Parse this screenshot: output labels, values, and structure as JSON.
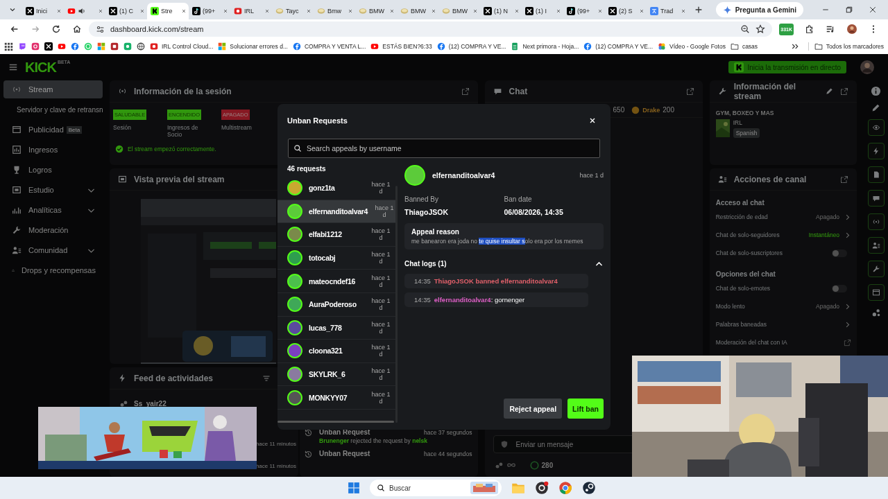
{
  "browser": {
    "tabs": [
      {
        "title": "Inici",
        "kind": "x",
        "selected": false,
        "audio": false
      },
      {
        "kind": "youtube",
        "selected": false,
        "audio": true
      },
      {
        "title": "(1) C",
        "kind": "x",
        "selected": false,
        "audio": false
      },
      {
        "title": "Stre",
        "kind": "kick",
        "selected": true,
        "audio": false
      },
      {
        "title": "(99+",
        "kind": "tiktok",
        "selected": false,
        "audio": false
      },
      {
        "title": "IRL",
        "kind": "irl",
        "selected": false,
        "audio": false
      },
      {
        "title": "Tayc",
        "kind": "coin",
        "selected": false,
        "audio": false
      },
      {
        "title": "Bmw",
        "kind": "coin",
        "selected": false,
        "audio": false
      },
      {
        "title": "BMW",
        "kind": "coin",
        "selected": false,
        "audio": false
      },
      {
        "title": "BMW",
        "kind": "coin",
        "selected": false,
        "audio": false
      },
      {
        "title": "BMW",
        "kind": "coin",
        "selected": false,
        "audio": false
      },
      {
        "title": "(1) N",
        "kind": "x",
        "selected": false,
        "audio": false
      },
      {
        "title": "(1) I",
        "kind": "x",
        "selected": false,
        "audio": false
      },
      {
        "title": "(99+",
        "kind": "tiktok",
        "selected": false,
        "audio": false
      },
      {
        "title": "(2) S",
        "kind": "x",
        "selected": false,
        "audio": false
      },
      {
        "title": "Trad",
        "kind": "translate",
        "selected": false,
        "audio": false
      }
    ],
    "gemini_button": "Pregunta a Gemini",
    "url": "dashboard.kick.com/stream",
    "extension_badge": "331K",
    "bookmarks": [
      {
        "kind": "twitch"
      },
      {
        "kind": "instagram"
      },
      {
        "kind": "x"
      },
      {
        "kind": "youtube"
      },
      {
        "kind": "facebook"
      },
      {
        "kind": "whatsapp"
      },
      {
        "kind": "microsoft"
      },
      {
        "kind": "app"
      },
      {
        "kind": "greenapp"
      },
      {
        "kind": "globe"
      },
      {
        "kind": "irl",
        "label": "IRL Control Cloud..."
      },
      {
        "kind": "microsoft",
        "label": "Solucionar errores d..."
      },
      {
        "kind": "facebook",
        "label": "COMPRA Y VENTA L..."
      },
      {
        "kind": "youtube",
        "label": "ESTÁS BIEN?6:33"
      },
      {
        "kind": "facebook",
        "label": "(12) COMPRA Y VE..."
      },
      {
        "kind": "sheets",
        "label": "Next primora - Hoja..."
      },
      {
        "kind": "facebook",
        "label": "(12) COMPRA Y VE..."
      },
      {
        "kind": "photos",
        "label": "Vídeo - Google Fotos"
      },
      {
        "kind": "folder",
        "label": "casas"
      }
    ],
    "all_bookmarks": "Todos los marcadores"
  },
  "dashboard": {
    "logo": "KICK",
    "logo_tag": "BETA",
    "go_live_button": "Inicia la transmisión en directo",
    "sidebar": [
      {
        "label": "Stream",
        "kind": "link",
        "selected": true
      },
      {
        "label": "Servidor y clave de retransn",
        "kind": "sub",
        "selected": false
      },
      {
        "label": "Publicidad",
        "kind": "link",
        "badge": "Beta",
        "selected": false
      },
      {
        "label": "Ingresos",
        "kind": "link",
        "selected": false
      },
      {
        "label": "Logros",
        "kind": "link",
        "selected": false
      },
      {
        "label": "Estudio",
        "kind": "group",
        "selected": false
      },
      {
        "label": "Analíticas",
        "kind": "group",
        "selected": false
      },
      {
        "label": "Moderación",
        "kind": "link",
        "selected": false
      },
      {
        "label": "Comunidad",
        "kind": "group",
        "selected": false
      },
      {
        "label": "Drops y recompensas",
        "kind": "link",
        "selected": false
      }
    ],
    "session": {
      "title": "Información de la sesión",
      "stats": [
        {
          "badge": "SALUDABLE",
          "label": "Sesión",
          "kind": "ok"
        },
        {
          "badge": "ENCENDIDO",
          "label": "Ingresos de Socio",
          "kind": "ok"
        },
        {
          "badge": "APAGADO",
          "label": "Multistream",
          "kind": "off"
        }
      ],
      "message": "El stream empezó correctamente."
    },
    "preview": {
      "title": "Vista previa del stream"
    },
    "feed": {
      "title": "Feed de actividades",
      "items": [
        {
          "user": "Ss_yair22"
        },
        {
          "time": "hace 11 minutos"
        },
        {
          "time": "hace 11 minutos"
        }
      ]
    },
    "mod_log": {
      "items": [
        {
          "title": "Unban Request",
          "time": "hace 37 segundos",
          "detail": "**Brunenger** rejected the request by **nelsk**"
        },
        {
          "title": "Unban Request",
          "time": "hace 44 segundos"
        }
      ]
    },
    "chat": {
      "title": "Chat",
      "leaders": [
        {
          "value": "650"
        },
        {
          "name": "Drake",
          "value": "200"
        }
      ],
      "input_placeholder": "Enviar un mensaje",
      "points": "280"
    },
    "stream_info": {
      "title": "Información del stream",
      "stream_title": "GYM, BOXEO Y MAS",
      "category": "IRL",
      "language": "Spanish"
    },
    "channel_actions": {
      "title": "Acciones de canal",
      "sections": [
        {
          "heading": "Acceso al chat",
          "rows": [
            {
              "label": "Restricción de edad",
              "kind": "select",
              "value": "Apagado",
              "active": false
            },
            {
              "label": "Chat de solo-seguidores",
              "kind": "select",
              "value": "Instantáneo",
              "active": true
            },
            {
              "label": "Chat de solo-suscriptores",
              "kind": "toggle",
              "on": false
            }
          ]
        },
        {
          "heading": "Opciones del chat",
          "rows": [
            {
              "label": "Chat de solo-emotes",
              "kind": "toggle",
              "on": false
            },
            {
              "label": "Modo lento",
              "kind": "select",
              "value": "Apagado",
              "active": false
            },
            {
              "label": "Palabras baneadas",
              "kind": "link"
            },
            {
              "label": "Moderación del chat con IA",
              "kind": "external"
            }
          ]
        }
      ]
    }
  },
  "modal": {
    "title": "Unban Requests",
    "search_placeholder": "Search appeals by username",
    "count": "46 requests",
    "requests": [
      {
        "user": "gonz1ta",
        "time": "hace 1 d",
        "selected": false,
        "color": "#c9a830"
      },
      {
        "user": "elfernanditoalvar4",
        "time": "hace 1 d",
        "selected": true,
        "color": "#5ccb3a"
      },
      {
        "user": "elfabi1212",
        "time": "hace 1 d",
        "selected": false,
        "color": "#7a8a4a"
      },
      {
        "user": "totocabj",
        "time": "hace 1 d",
        "selected": false,
        "color": "#2e9e4e"
      },
      {
        "user": "mateocndef16",
        "time": "hace 1 d",
        "selected": false,
        "color": "#4cbf4c"
      },
      {
        "user": "AuraPoderoso",
        "time": "hace 1 d",
        "selected": false,
        "color": "#3fa858"
      },
      {
        "user": "lucas_778",
        "time": "hace 1 d",
        "selected": false,
        "color": "#5b4a9e"
      },
      {
        "user": "cloona321",
        "time": "hace 1 d",
        "selected": false,
        "color": "#7b3fbf"
      },
      {
        "user": "SKYLRK_6",
        "time": "hace 1 d",
        "selected": false,
        "color": "#8a7aa0"
      },
      {
        "user": "MONKYY07",
        "time": "hace 1 d",
        "selected": false,
        "color": "#555555"
      }
    ],
    "detail": {
      "user": "elfernanditoalvar4",
      "time": "hace 1 d",
      "color": "#5ccb3a",
      "banned_by_label": "Banned By",
      "banned_by": "ThiagoJSOK",
      "ban_date_label": "Ban date",
      "ban_date": "06/08/2026, 14:35",
      "reason_label": "Appeal reason",
      "reason": {
        "before": "me banearon era joda no ",
        "selected": "te quise insultar s",
        "after": "olo era por los memes"
      },
      "logs_title": "Chat logs (1)",
      "logs_expanded": true,
      "logs": [
        {
          "time": "14:35",
          "kind": "system",
          "text": "ThiagoJSOK banned elfernanditoalvar4"
        },
        {
          "time": "14:35",
          "kind": "message",
          "user": "elfernanditoalvar4",
          "text": ": gornenger"
        }
      ]
    },
    "reject_button": "Reject appeal",
    "lift_button": "Lift ban"
  },
  "taskbar": {
    "search_placeholder": "Buscar"
  }
}
